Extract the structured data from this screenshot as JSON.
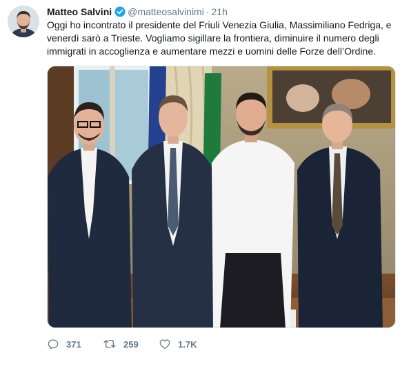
{
  "tweet": {
    "author_name": "Matteo Salvini",
    "handle": "@matteosalvinimi",
    "separator": "·",
    "time": "21h",
    "text_lines": [
      "Oggi ho incontrato il presidente del Friuli Venezia Giulia, Massimiliano Fedriga, e",
      "venerdì sarò a Trieste. Vogliamo sigillare la frontiera, diminuire il numero degli",
      "immigrati in accoglienza e aumentare mezzi e uomini delle Forze dell’Ordine."
    ]
  },
  "actions": {
    "reply_count": "371",
    "retweet_count": "259",
    "like_count": "1.7K"
  },
  "icons": {
    "verified": "verified-badge-icon",
    "reply": "reply-icon",
    "retweet": "retweet-icon",
    "like": "heart-icon"
  },
  "colors": {
    "verified_blue": "#1da1f2",
    "text_primary": "#14171a",
    "text_secondary": "#657786"
  }
}
